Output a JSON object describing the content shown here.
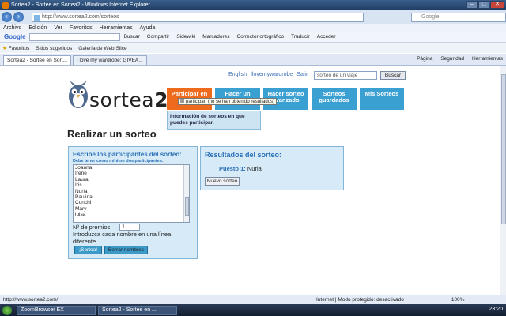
{
  "window": {
    "title": "Sortea2 - Sortee en Sortea2 - Windows Internet Explorer",
    "min": "–",
    "max": "□",
    "close": "✕"
  },
  "address": {
    "url": "http://www.sortea2.com/sorteos",
    "search_placeholder": "Google"
  },
  "menu": [
    "Archivo",
    "Edición",
    "Ver",
    "Favoritos",
    "Herramientas",
    "Ayuda"
  ],
  "google_toolbar": {
    "logo": "Google",
    "items": [
      "Buscar",
      "Compartir",
      "Sidewiki",
      "Marcadores",
      "Corrector ortográfico",
      "Traducir",
      "Acceder"
    ]
  },
  "favorites": {
    "label": "Favoritos",
    "items": [
      "Sitios sugeridos",
      "Galería de Web Slice"
    ]
  },
  "tabs": [
    {
      "label": "Sortea2 - Sortee en Sort...",
      "active": true
    },
    {
      "label": "I love my wardrobe: GIVEA...",
      "active": false
    }
  ],
  "tab_tools": [
    "Página",
    "Seguridad",
    "Herramientas"
  ],
  "page": {
    "top_links": [
      "English",
      "Ilovemywardrobe",
      "Salir"
    ],
    "search_value": "sorteo de un viaje",
    "search_button": "Buscar",
    "logo": {
      "prefix": "sortea",
      "suffix": "2"
    },
    "nav": [
      {
        "label": "Participar en sorteos",
        "active": true
      },
      {
        "label": "Hacer un sorteo",
        "active": false
      },
      {
        "label": "Hacer sorteo avanzado",
        "active": false
      },
      {
        "label": "Sorteos guardados",
        "active": false
      },
      {
        "label": "Mis Sorteos",
        "active": false
      }
    ],
    "tooltip": "participar. (no se han obtenido resultados)",
    "info": "Información de sorteos en que puedes participar.",
    "heading": "Realizar un sorteo",
    "left": {
      "title": "Escribe los participantes del sorteo:",
      "subtitle": "Debe tener como mínimo dos participantes.",
      "names": [
        "Joanna",
        "Irene",
        "Laura",
        "Iris",
        "Nuria",
        "Paulina",
        "Conchi",
        "Mary",
        "luisa"
      ],
      "premios_label": "Nº de premios:",
      "premios_value": "1",
      "instructions": "Introduzca cada nombre en una línea diferente.",
      "btn_sortea": "¡Sortea!",
      "btn_borrar": "Borrar nombres"
    },
    "right": {
      "title": "Resultados del sorteo:",
      "puesto_label": "Puesto 1:",
      "puesto_value": "Nuria",
      "btn_nuevo": "Nuevo sorteo"
    }
  },
  "status": {
    "url": "http://www.sortea2.com/",
    "zone": "Internet | Modo protegido: desactivado",
    "zoom": "100%"
  },
  "taskbar": {
    "tasks": [
      "ZoomBrowser EX",
      "Sortea2 - Sortee en ..."
    ],
    "clock": "23:20"
  },
  "colors": {
    "nav_active": "#ee6a1c",
    "nav_default": "#3aa0d2",
    "box_bg": "#d6ebf7",
    "heading_blue": "#2a6fb5"
  }
}
